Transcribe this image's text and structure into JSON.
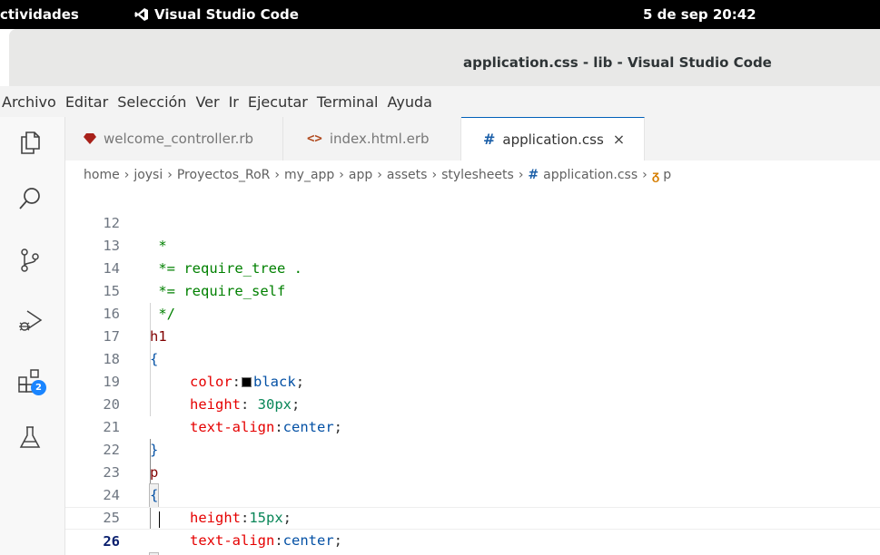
{
  "topbar": {
    "activities": "ctividades",
    "app_name": "Visual Studio Code",
    "clock": "5 de sep  20:42"
  },
  "window": {
    "title": "application.css - lib - Visual Studio Code"
  },
  "menu": [
    "Archivo",
    "Editar",
    "Selección",
    "Ver",
    "Ir",
    "Ejecutar",
    "Terminal",
    "Ayuda"
  ],
  "activitybar": {
    "icons": [
      "files-icon",
      "search-icon",
      "source-control-icon",
      "run-debug-icon",
      "extensions-icon",
      "testing-icon"
    ],
    "extensions_badge": "2"
  },
  "tabs": [
    {
      "label": "welcome_controller.rb",
      "icon": "ruby-icon",
      "active": false
    },
    {
      "label": "index.html.erb",
      "icon": "html-icon",
      "active": false
    },
    {
      "label": "application.css",
      "icon": "css-hash-icon",
      "active": true
    }
  ],
  "tab_close": "×",
  "breadcrumb": {
    "parts": [
      "home",
      "joysi",
      "Proyectos_RoR",
      "my_app",
      "app",
      "assets",
      "stylesheets"
    ],
    "file": "application.css",
    "symbol": "p"
  },
  "editor": {
    "lines": [
      {
        "n": "12",
        "text": " *"
      },
      {
        "n": "13",
        "text": " *= require_tree ."
      },
      {
        "n": "14",
        "text": " *= require_self"
      },
      {
        "n": "15",
        "text": " */"
      },
      {
        "n": "16",
        "text": "h1"
      },
      {
        "n": "17",
        "text": "{"
      },
      {
        "n": "18",
        "prop": "color",
        "value": "black"
      },
      {
        "n": "19",
        "prop": "height",
        "value": "30px"
      },
      {
        "n": "20",
        "prop": "text-align",
        "value": "center"
      },
      {
        "n": "21",
        "text": "}"
      },
      {
        "n": "22",
        "text": "p"
      },
      {
        "n": "23",
        "text": "{"
      },
      {
        "n": "24",
        "prop": "height",
        "value": "15px"
      },
      {
        "n": "25",
        "prop": "text-align",
        "value": "center"
      },
      {
        "n": "26",
        "text": "}"
      }
    ],
    "current_line": "26"
  },
  "colors": {
    "comment": "#008000",
    "selector": "#800000",
    "property": "#e50000",
    "value": "#0451a5",
    "number": "#098658",
    "accent": "#005fb8",
    "badge": "#1a85ff"
  }
}
